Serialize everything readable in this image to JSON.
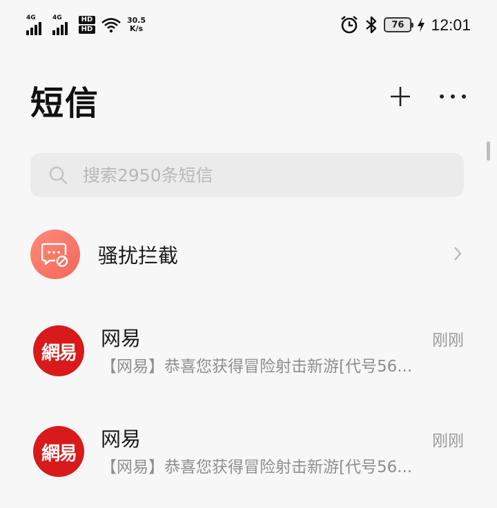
{
  "status_bar": {
    "signal1_tag": "4G",
    "signal2_tag": "4G",
    "hd_top": "HD",
    "hd_bottom": "HD",
    "net_speed_value": "30.5",
    "net_speed_unit": "K/s",
    "battery_level": "76",
    "time": "12:01",
    "icons": [
      "signal-icon",
      "wifi-icon",
      "alarm-icon",
      "bluetooth-icon",
      "battery-icon",
      "charging-icon"
    ]
  },
  "header": {
    "title": "短信",
    "add_icon": "plus-icon",
    "more_icon": "more-dots-icon"
  },
  "search": {
    "placeholder": "搜索2950条短信",
    "value": "",
    "icon": "search-icon"
  },
  "spam_filter": {
    "label": "骚扰拦截",
    "icon": "blocked-message-icon",
    "accent": "#f4675a"
  },
  "messages": [
    {
      "avatar_text": "網易",
      "sender": "网易",
      "time": "刚刚",
      "preview": "【网易】恭喜您获得冒险射击新游[代号56..."
    },
    {
      "avatar_text": "網易",
      "sender": "网易",
      "time": "刚刚",
      "preview": "【网易】恭喜您获得冒险射击新游[代号56..."
    }
  ],
  "colors": {
    "background": "#f7f7f7",
    "avatar_red": "#d81a1a",
    "search_bg": "#ebebeb"
  }
}
